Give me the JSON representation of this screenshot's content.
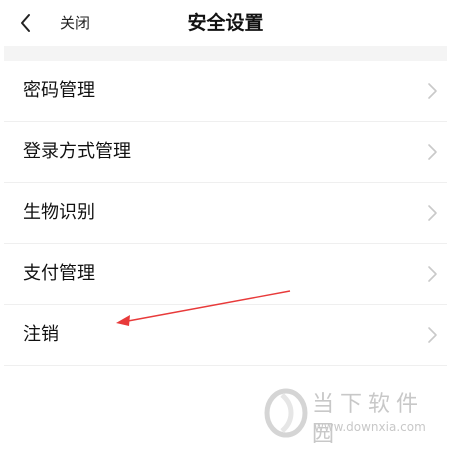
{
  "header": {
    "close_label": "关闭",
    "title": "安全设置"
  },
  "menu": {
    "items": [
      {
        "label": "密码管理"
      },
      {
        "label": "登录方式管理"
      },
      {
        "label": "生物识别"
      },
      {
        "label": "支付管理"
      },
      {
        "label": "注销"
      }
    ]
  },
  "watermark": {
    "name": "当下软件园",
    "url": "www.downxia.com"
  },
  "colors": {
    "annotation_arrow": "#e83a3a",
    "chevron": "#c9c9c9",
    "band": "#f4f4f4",
    "watermark": "#c8c8c8"
  }
}
